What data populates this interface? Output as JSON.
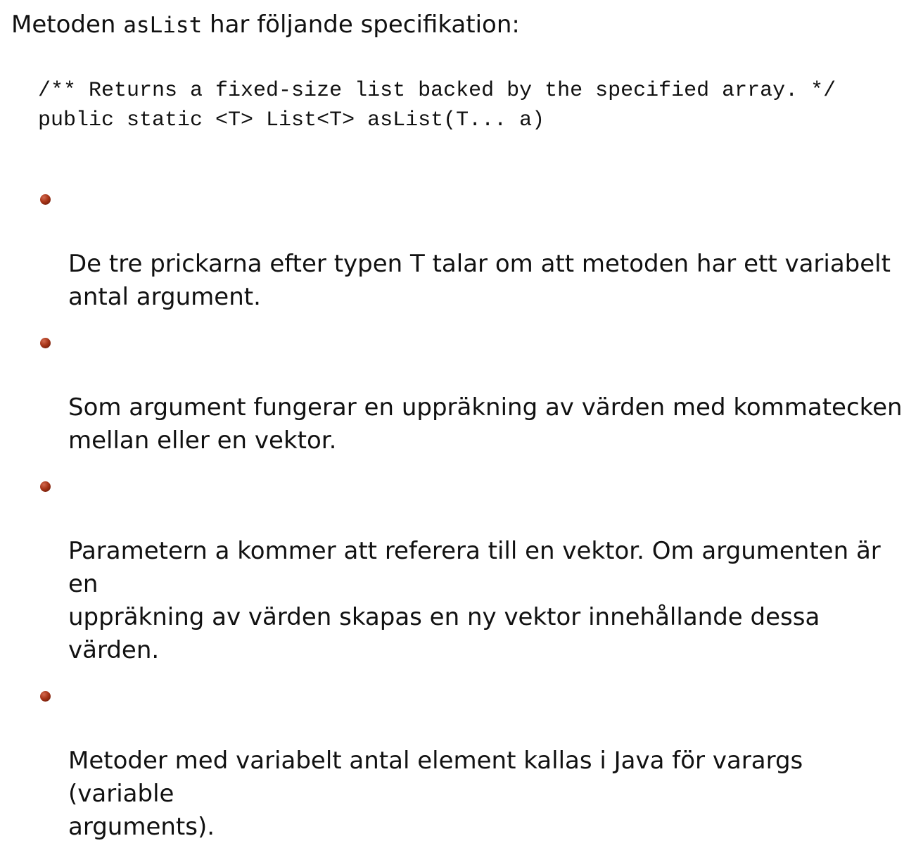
{
  "intro": {
    "prefix": "Metoden ",
    "method": "asList",
    "suffix": " har följande specifikation:"
  },
  "code": {
    "line1": "/** Returns a fixed-size list backed by the specified array. */",
    "line2": "public static <T> List<T> asList(T... a)"
  },
  "bullets": [
    {
      "text": "De tre prickarna efter typen T talar om att metoden har ett variabelt\nantal argument."
    },
    {
      "text": "Som argument fungerar en uppräkning av värden med kommatecken\nmellan eller en vektor."
    },
    {
      "text": "Parametern a kommer att referera till en vektor. Om argumenten är en\nuppräkning av värden skapas en ny vektor innehållande dessa värden."
    },
    {
      "text": "Metoder med variabelt antal element kallas i Java för varargs (variable\narguments)."
    }
  ],
  "colors": {
    "bullet": "#a83518",
    "text": "#111111",
    "background": "#ffffff"
  }
}
